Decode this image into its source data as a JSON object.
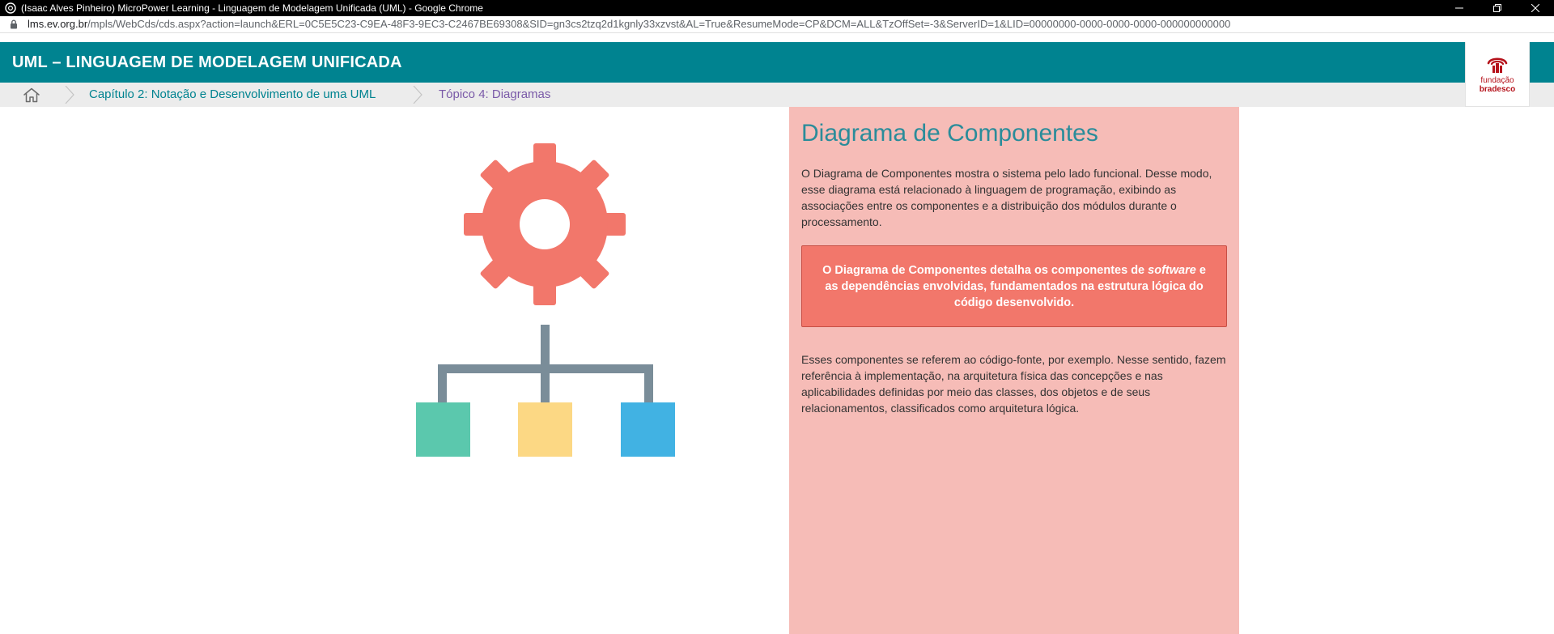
{
  "window": {
    "title": "(Isaac Alves Pinheiro) MicroPower Learning - Linguagem de Modelagem Unificada (UML) - Google Chrome"
  },
  "address_bar": {
    "host": "lms.ev.org.br",
    "path": "/mpls/WebCds/cds.aspx?action=launch&ERL=0C5E5C23-C9EA-48F3-9EC3-C2467BE69308&SID=gn3cs2tzq2d1kgnly33xzvst&AL=True&ResumeMode=CP&DCM=ALL&TzOffSet=-3&ServerID=1&LID=00000000-0000-0000-0000-000000000000"
  },
  "header": {
    "course_title": "UML – LINGUAGEM DE MODELAGEM UNIFICADA",
    "logo_line1": "fundação",
    "logo_line2": "bradesco"
  },
  "breadcrumb": {
    "chapter": "Capítulo 2: Notação e Desenvolvimento de uma UML",
    "topic": "Tópico 4: Diagramas"
  },
  "content": {
    "title": "Diagrama de Componentes",
    "paragraph1": "O Diagrama de Componentes mostra o sistema pelo lado funcional. Desse modo, esse diagrama está relacionado à linguagem de programação, exibindo as associações entre os componentes e a distribuição dos módulos durante o processamento.",
    "callout_before": "O Diagrama de Componentes detalha os componentes de ",
    "callout_emphasis": "software",
    "callout_after": " e as dependências envolvidas, fundamentados na estrutura lógica do código desenvolvido.",
    "paragraph2": "Esses componentes se referem ao código-fonte, por exemplo. Nesse sentido, fazem referência à implementação, na arquitetura física das concepções e nas aplicabilidades definidas por meio das classes, dos objetos e de seus relacionamentos, classificados como arquitetura lógica."
  },
  "icons": {
    "gear": "gear-icon",
    "hierarchy": "hierarchy-icon",
    "home": "home-icon",
    "lock": "lock-icon"
  },
  "colors": {
    "header": "#008390",
    "panel": "#f6bcb7",
    "callout": "#f2776b",
    "gear": "#f2776b",
    "connector": "#7a8d99",
    "box_green": "#5bc8ad",
    "box_yellow": "#fcd884",
    "box_blue": "#41b2e3"
  }
}
